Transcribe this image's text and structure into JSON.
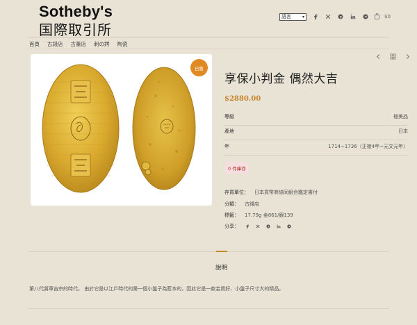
{
  "header": {
    "logo_en": "Sotheby's",
    "logo_zh": "国際取引所",
    "language": "語言",
    "cart_total": "$0"
  },
  "nav": {
    "items": [
      "首頁",
      "古錢店",
      "古董店",
      "刺の鍔",
      "陶瓷"
    ],
    "active_index": 1
  },
  "product": {
    "badge": "已售",
    "title": "享保小判金 偶然大吉",
    "price": "$2880.00",
    "attributes": [
      {
        "label": "等級",
        "value": "極美品"
      },
      {
        "label": "產地",
        "value": "日本"
      },
      {
        "label": "年",
        "value": "1714~1736（正徳4年~元文元年）"
      }
    ],
    "stock": "0 件庫存",
    "sku_label": "存貨單位：",
    "sku_value": "日本貨幣商協同組合鑑定書付",
    "category_label": "分類：",
    "category_value": "古錢店",
    "tags_label": "標籤：",
    "tags_value": "17.79g 金861/銀139",
    "share_label": "分享："
  },
  "tabs": {
    "description_label": "說明"
  },
  "description": "第八代將軍吉宗的時代。 由於它是以江戶時代的第一個小盤子為藍本的，因此它是一款金質好、小盤子尺寸大的精品。",
  "colors": {
    "background": "#e9e3d6",
    "accent": "#c8862c",
    "badge": "#df8a23",
    "gold": "#d4a92c"
  }
}
